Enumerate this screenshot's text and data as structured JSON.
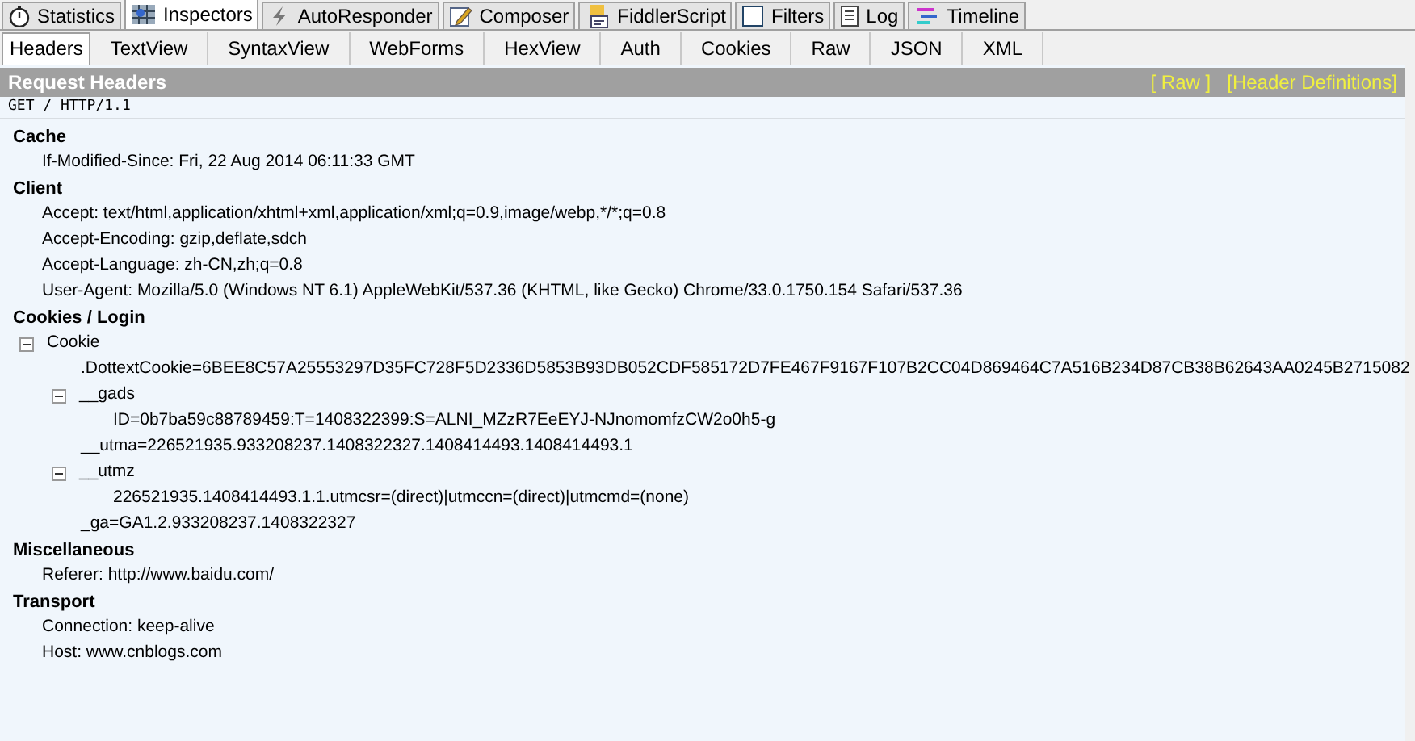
{
  "top_tabs": [
    {
      "label": "Statistics",
      "selected": false
    },
    {
      "label": "Inspectors",
      "selected": true
    },
    {
      "label": "AutoResponder",
      "selected": false
    },
    {
      "label": "Composer",
      "selected": false
    },
    {
      "label": "FiddlerScript",
      "selected": false
    },
    {
      "label": "Filters",
      "selected": false
    },
    {
      "label": "Log",
      "selected": false
    },
    {
      "label": "Timeline",
      "selected": false
    }
  ],
  "sub_tabs": [
    {
      "label": "Headers",
      "selected": true
    },
    {
      "label": "TextView",
      "selected": false
    },
    {
      "label": "SyntaxView",
      "selected": false
    },
    {
      "label": "WebForms",
      "selected": false
    },
    {
      "label": "HexView",
      "selected": false
    },
    {
      "label": "Auth",
      "selected": false
    },
    {
      "label": "Cookies",
      "selected": false
    },
    {
      "label": "Raw",
      "selected": false
    },
    {
      "label": "JSON",
      "selected": false
    },
    {
      "label": "XML",
      "selected": false
    }
  ],
  "header_bar": {
    "title": "Request Headers",
    "links": [
      "[ Raw ]",
      "[Header Definitions]"
    ]
  },
  "request_line": "GET / HTTP/1.1",
  "groups": [
    {
      "title": "Cache",
      "items": [
        {
          "text": "If-Modified-Since: Fri, 22 Aug 2014 06:11:33 GMT"
        }
      ]
    },
    {
      "title": "Client",
      "items": [
        {
          "text": "Accept: text/html,application/xhtml+xml,application/xml;q=0.9,image/webp,*/*;q=0.8"
        },
        {
          "text": "Accept-Encoding: gzip,deflate,sdch"
        },
        {
          "text": "Accept-Language: zh-CN,zh;q=0.8"
        },
        {
          "text": "User-Agent: Mozilla/5.0 (Windows NT 6.1) AppleWebKit/537.36 (KHTML, like Gecko) Chrome/33.0.1750.154 Safari/537.36"
        }
      ]
    },
    {
      "title": "Cookies / Login",
      "items": [
        {
          "text": "Cookie",
          "expanded": true,
          "children": [
            {
              "text": ".DottextCookie=6BEE8C57A25553297D35FC728F5D2336D5853B93DB052CDF585172D7FE467F9167F107B2CC04D869464C7A516B234D87CB38B62643AA0245B2715082"
            },
            {
              "text": "__gads",
              "expanded": true,
              "children": [
                {
                  "text": "ID=0b7ba59c88789459:T=1408322399:S=ALNI_MZzR7EeEYJ-NJnomomfzCW2o0h5-g"
                }
              ]
            },
            {
              "text": "__utma=226521935.933208237.1408322327.1408414493.1408414493.1"
            },
            {
              "text": "__utmz",
              "expanded": true,
              "children": [
                {
                  "text": "226521935.1408414493.1.1.utmcsr=(direct)|utmccn=(direct)|utmcmd=(none)"
                }
              ]
            },
            {
              "text": "_ga=GA1.2.933208237.1408322327"
            }
          ]
        }
      ]
    },
    {
      "title": "Miscellaneous",
      "items": [
        {
          "text": "Referer: http://www.baidu.com/"
        }
      ]
    },
    {
      "title": "Transport",
      "items": [
        {
          "text": "Connection: keep-alive"
        },
        {
          "text": "Host: www.cnblogs.com"
        }
      ]
    }
  ]
}
